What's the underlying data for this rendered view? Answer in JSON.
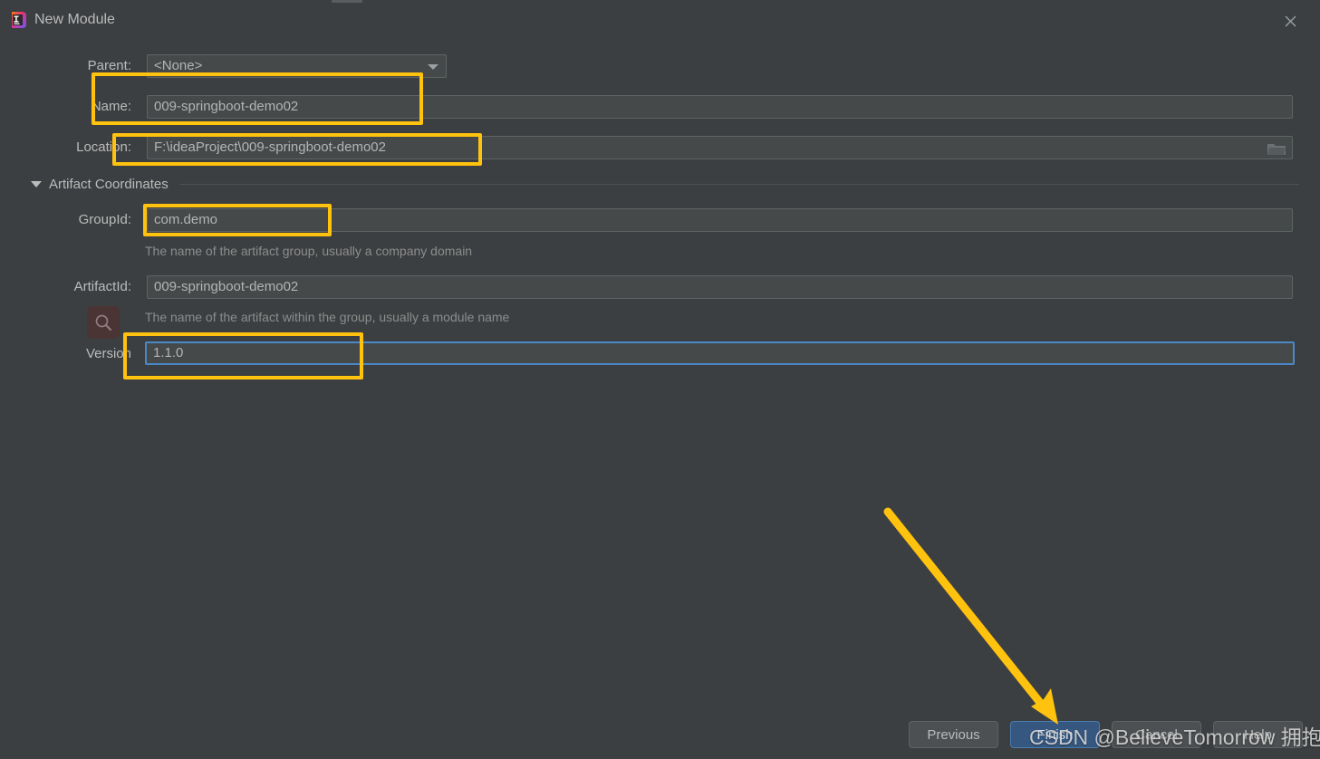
{
  "window": {
    "title": "New Module",
    "app_icon": "intellij-idea-icon",
    "close_label": "✕"
  },
  "form": {
    "parent": {
      "label": "Parent:",
      "value": "<None>",
      "icon": "chevron-down-icon"
    },
    "name": {
      "label": "Name:",
      "value": "009-springboot-demo02"
    },
    "location": {
      "label": "Location:",
      "value": "F:\\ideaProject\\009-springboot-demo02",
      "browse_icon": "folder-icon"
    },
    "section": {
      "label": "Artifact Coordinates",
      "expanded": true,
      "icon": "triangle-down-icon"
    },
    "group_id": {
      "label": "GroupId:",
      "value": "com.demo",
      "helper": "The name of the artifact group, usually a company domain"
    },
    "artifact_id": {
      "label": "ArtifactId:",
      "value": "009-springboot-demo02",
      "helper": "The name of the artifact within the group, usually a module name"
    },
    "version": {
      "label": "Version",
      "value": "1.1.0",
      "focused": true
    }
  },
  "overlay": {
    "search_icon": "search-icon"
  },
  "footer": {
    "previous": "Previous",
    "finish": "Finish",
    "cancel": "Cancel",
    "help": "Help"
  },
  "annotations": {
    "watermark": "CSDN @BelieveTomorrow 拥抱未来",
    "highlight_color": "#ffc20e",
    "arrow_color": "#ffc20e",
    "boxes": [
      {
        "name": "name-highlight"
      },
      {
        "name": "location-highlight"
      },
      {
        "name": "groupid-highlight"
      },
      {
        "name": "version-highlight"
      }
    ]
  },
  "colors": {
    "background": "#3c3f41",
    "field_background": "#45494a",
    "accent_blue": "#365880",
    "focus_blue": "#4a88c7",
    "text": "#bbbbbb",
    "helper_text": "#8c8c8c"
  }
}
